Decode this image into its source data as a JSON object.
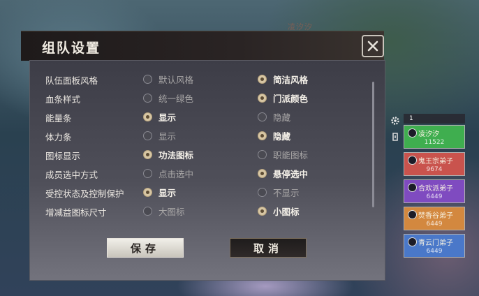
{
  "background": {
    "char_name": "凌汐汐"
  },
  "dialog": {
    "title": "组队设置",
    "rows": [
      {
        "label": "队伍面板风格",
        "a": "默认风格",
        "b": "简洁风格",
        "sel": "b"
      },
      {
        "label": "血条样式",
        "a": "统一绿色",
        "b": "门派颜色",
        "sel": "b"
      },
      {
        "label": "能量条",
        "a": "显示",
        "b": "隐藏",
        "sel": "a"
      },
      {
        "label": "体力条",
        "a": "显示",
        "b": "隐藏",
        "sel": "b"
      },
      {
        "label": "图标显示",
        "a": "功法图标",
        "b": "职能图标",
        "sel": "a"
      },
      {
        "label": "成员选中方式",
        "a": "点击选中",
        "b": "悬停选中",
        "sel": "b"
      },
      {
        "label": "受控状态及控制保护",
        "a": "显示",
        "b": "不显示",
        "sel": "a"
      },
      {
        "label": "增减益图标尺寸",
        "a": "大图标",
        "b": "小图标",
        "sel": "b"
      }
    ],
    "save_label": "保存",
    "cancel_label": "取消"
  },
  "team": {
    "header": "1",
    "members": [
      {
        "name": "凌汐汐",
        "value": "11522",
        "color": "#3fae4f"
      },
      {
        "name": "鬼王宗弟子",
        "value": "9674",
        "color": "#c9534d"
      },
      {
        "name": "合欢派弟子",
        "value": "6449",
        "color": "#7f4bc0"
      },
      {
        "name": "焚香谷弟子",
        "value": "6449",
        "color": "#d3883f"
      },
      {
        "name": "青云门弟子",
        "value": "6449",
        "color": "#4a78c9"
      }
    ]
  },
  "colors": {
    "radio_on": "#d7c6a4",
    "dialog_header": "#1e1a1a"
  }
}
